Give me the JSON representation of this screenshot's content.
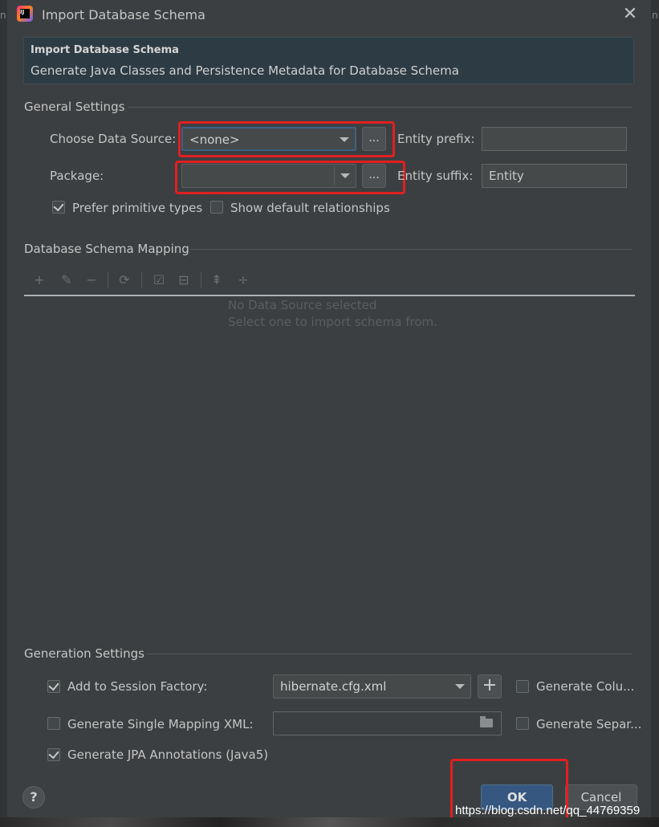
{
  "window": {
    "title": "Import Database Schema",
    "close_glyph": "✕"
  },
  "header": {
    "title": "Import Database Schema",
    "subtitle": "Generate Java Classes and Persistence Metadata for Database Schema"
  },
  "general": {
    "section_title": "General Settings",
    "data_source_label": "Choose Data Source:",
    "data_source_value": "<none>",
    "package_label": "Package:",
    "package_value": "",
    "browse_label": "...",
    "entity_prefix_label": "Entity prefix:",
    "entity_prefix_value": "",
    "entity_suffix_label": "Entity suffix:",
    "entity_suffix_value": "Entity",
    "prefer_primitive_label": "Prefer primitive types",
    "prefer_primitive_checked": true,
    "show_default_label": "Show default relationships",
    "show_default_checked": false
  },
  "mapping": {
    "section_title": "Database Schema Mapping",
    "toolbar_icons": [
      "add-icon",
      "edit-icon",
      "remove-icon",
      "refresh-icon",
      "check-all-icon",
      "uncheck-all-icon",
      "expand-all-icon",
      "collapse-all-icon"
    ],
    "empty_line1": "No Data Source selected",
    "empty_line2": "Select one to import schema from."
  },
  "generation": {
    "section_title": "Generation Settings",
    "add_session_label": "Add to Session Factory:",
    "add_session_checked": true,
    "session_value": "hibernate.cfg.xml",
    "plus_label": "+",
    "gen_columns_label": "Generate Colu...",
    "gen_columns_checked": false,
    "single_mapping_label": "Generate Single Mapping XML:",
    "single_mapping_checked": false,
    "single_mapping_value": "",
    "gen_separate_label": "Generate Separ...",
    "gen_separate_checked": false,
    "jpa_label": "Generate JPA Annotations (Java5)",
    "jpa_checked": true
  },
  "footer": {
    "help_label": "?",
    "ok_label": "OK",
    "cancel_label": "Cancel"
  },
  "watermark": "https://blog.csdn.net/qq_44769359",
  "colors": {
    "dialog_bg": "#3c3f41",
    "header_bg": "#2d3b45",
    "accent_ok": "#365880",
    "highlight_red": "#e02020"
  }
}
